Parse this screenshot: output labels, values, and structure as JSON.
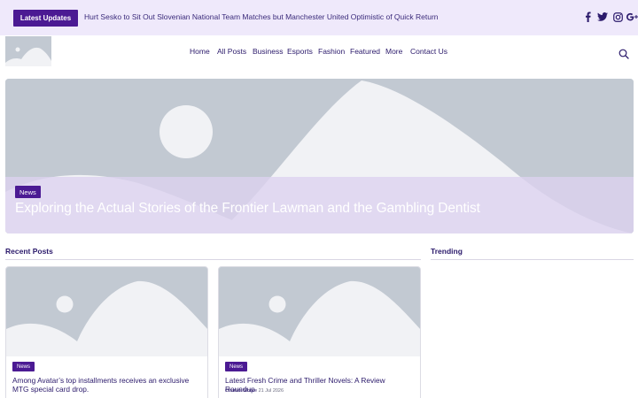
{
  "topbar": {
    "latest_label": "Latest Updates",
    "ticker_text": "Hurt Sesko to Sit Out Slovenian National Team Matches but Manchester United Optimistic of Quick Return",
    "social_icons": [
      "facebook-icon",
      "twitter-icon",
      "instagram-icon",
      "google-plus-icon"
    ]
  },
  "nav": {
    "items": [
      "Home",
      "All Posts",
      "Business",
      "Esports",
      "Fashion",
      "Featured",
      "More",
      "Contact Us"
    ]
  },
  "hero": {
    "tag": "News",
    "title": "Exploring the Actual Stories of the Frontier Lawman and the Gambling Dentist"
  },
  "sections": {
    "recent": "Recent Posts",
    "trending": "Trending"
  },
  "cards": [
    {
      "tag": "News",
      "title": "Among Avatar’s top installments receives an exclusive MTG special card drop.",
      "author": "",
      "date": ""
    },
    {
      "tag": "News",
      "title": "Latest Fresh Crime and Thriller Novels: A Review Roundup",
      "author": "Charles Moore",
      "date": "21 Jul 2026"
    }
  ],
  "colors": {
    "accent": "#4b1a93",
    "topbar_bg": "#efe9fb",
    "placeholder": "#c2c9d2",
    "text": "#2b1a6b"
  }
}
